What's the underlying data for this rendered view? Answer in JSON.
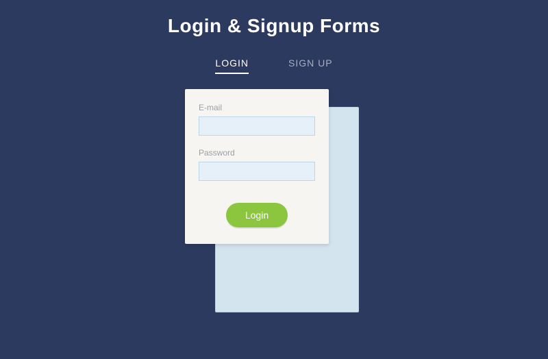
{
  "title": "Login & Signup Forms",
  "tabs": {
    "login": "LOGIN",
    "signup": "SIGN UP"
  },
  "form": {
    "email_label": "E-mail",
    "email_value": "",
    "password_label": "Password",
    "password_value": "",
    "submit_label": "Login"
  }
}
